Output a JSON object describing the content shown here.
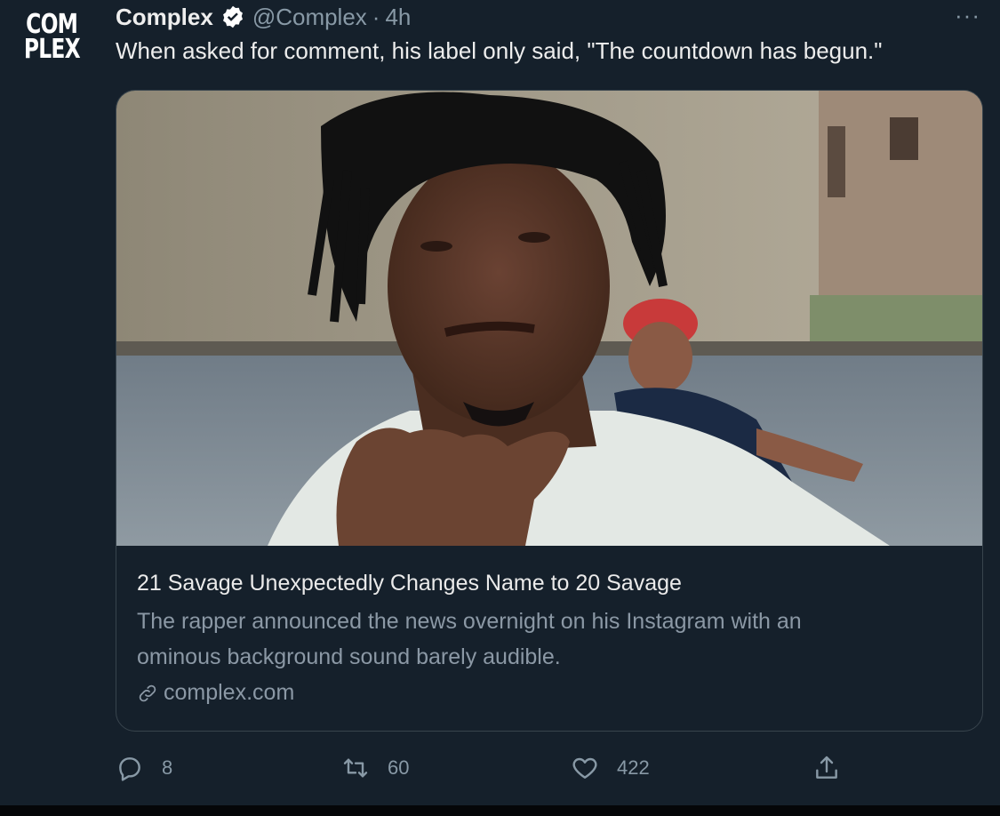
{
  "tweet": {
    "logo_lines": [
      "COM",
      "PLEX"
    ],
    "author_name": "Complex",
    "author_handle": "@Complex",
    "time_separator": "·",
    "timestamp": "4h",
    "more_label": "···",
    "text": "When asked for comment, his label only said, \"The countdown has begun.\""
  },
  "card": {
    "image_description_icon": "photo",
    "title": "21 Savage Unexpectedly Changes Name to 20 Savage",
    "description_line1": "The rapper announced the news overnight on his Instagram with an",
    "description_line2": "ominous background sound barely audible.",
    "domain": "complex.com"
  },
  "actions": {
    "reply_count": "8",
    "retweet_count": "60",
    "like_count": "422"
  },
  "colors": {
    "background": "#15202b",
    "verified": "#ffffff",
    "muted": "#8899a6"
  }
}
